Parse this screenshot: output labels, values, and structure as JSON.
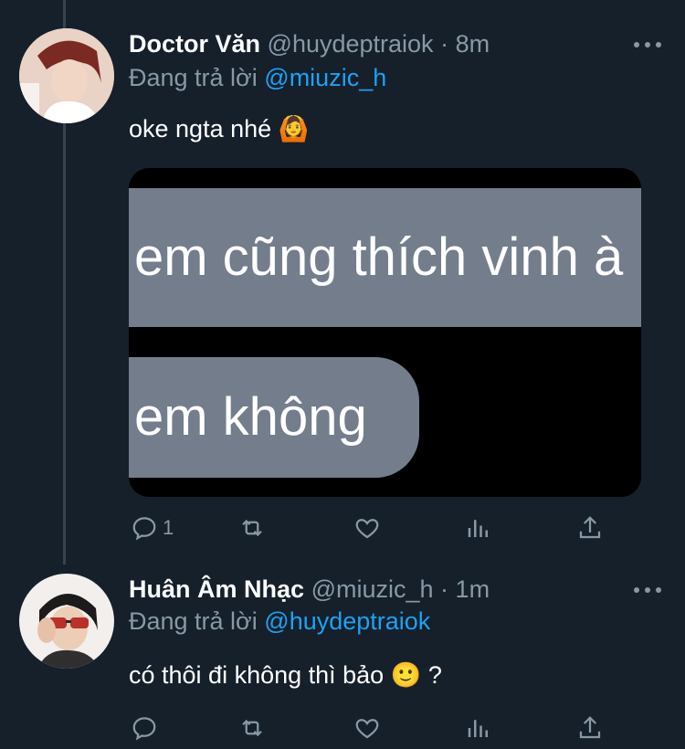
{
  "tweets": [
    {
      "author_name": "Doctor Văn",
      "handle": "@huydeptraiok",
      "separator": "·",
      "time": "8m",
      "replying_prefix": "Đang trả lời",
      "replying_to": "@miuzic_h",
      "text": "oke ngta nhé 🙆",
      "media": {
        "bubble_1_text": "em cũng thích vinh à",
        "bubble_2_text": "em không"
      },
      "reply_count": "1",
      "icons": [
        "reply-icon",
        "retweet-icon",
        "like-icon",
        "analytics-icon",
        "share-icon",
        "more-icon"
      ]
    },
    {
      "author_name": "Huân Âm Nhạc",
      "handle": "@miuzic_h",
      "separator": "·",
      "time": "1m",
      "replying_prefix": "Đang trả lời",
      "replying_to": "@huydeptraiok",
      "text": "có thôi đi không thì bảo 🙂 ?",
      "reply_count": "",
      "icons": [
        "reply-icon",
        "retweet-icon",
        "like-icon",
        "analytics-icon",
        "share-icon",
        "more-icon"
      ]
    }
  ],
  "colors": {
    "background": "#15202b",
    "secondary_text": "#8899a6",
    "link": "#1da1f2",
    "thread_line": "#38444d"
  }
}
